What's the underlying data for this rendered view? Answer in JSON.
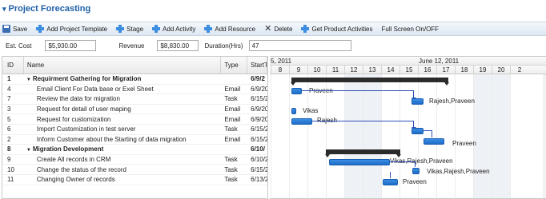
{
  "title": "Project Forecasting",
  "toolbar": {
    "save": "Save",
    "add_project_template": "Add Project Template",
    "stage": "Stage",
    "add_activity": "Add Activity",
    "add_resource": "Add Resource",
    "delete": "Delete",
    "get_product_activities": "Get Product Activities",
    "full_screen": "Full Screen On/OFF"
  },
  "fields": {
    "est_cost_label": "Est. Cost",
    "est_cost_value": "$5,930.00",
    "revenue_label": "Revenue",
    "revenue_value": "$8,830.00",
    "duration_label": "Duration(Hrs)",
    "duration_value": "47"
  },
  "grid": {
    "headers": {
      "id": "ID",
      "name": "Name",
      "type": "Type",
      "start": "StartTi"
    },
    "rows": [
      {
        "id": "1",
        "name": "Requirment Gathering for Migration",
        "type": "",
        "start": "6/9/2",
        "group": true
      },
      {
        "id": "4",
        "name": "Email Client For Data base or Exel Sheet",
        "type": "Email",
        "start": "6/9/20",
        "group": false
      },
      {
        "id": "7",
        "name": "Review the data for migration",
        "type": "Task",
        "start": "6/15/2",
        "group": false
      },
      {
        "id": "3",
        "name": "Request for detail of user maping",
        "type": "Email",
        "start": "6/9/20",
        "group": false
      },
      {
        "id": "5",
        "name": "Request for customization",
        "type": "Email",
        "start": "6/9/20",
        "group": false
      },
      {
        "id": "6",
        "name": "Import Customization in test server",
        "type": "Task",
        "start": "6/15/2",
        "group": false
      },
      {
        "id": "2",
        "name": "Inform Customer about the Starting of data migration",
        "type": "Email",
        "start": "6/15/2",
        "group": false
      },
      {
        "id": "8",
        "name": "Migration Development",
        "type": "",
        "start": "6/10/",
        "group": true
      },
      {
        "id": "9",
        "name": "Create All records in CRM",
        "type": "Task",
        "start": "6/10/2",
        "group": false
      },
      {
        "id": "10",
        "name": "Change the status of the record",
        "type": "Task",
        "start": "6/15/2",
        "group": false
      },
      {
        "id": "11",
        "name": "Changing Owner of records",
        "type": "Task",
        "start": "6/13/2",
        "group": false
      }
    ]
  },
  "gantt": {
    "week_left": "5, 2011",
    "week_right": "June 12, 2011",
    "days": [
      "8",
      "9",
      "10",
      "11",
      "12",
      "13",
      "14",
      "15",
      "16",
      "17",
      "18",
      "19",
      "20",
      "2"
    ],
    "resources": {
      "r_praveen_1": "Praveen",
      "r_rajesh_praveen": "Rajesh,Praveen",
      "r_vikas": "Vikas",
      "r_rajesh": "Rajesh",
      "r_praveen_2": "Praveen",
      "r_vikas_rajesh_praveen_1": "Vikas,Rajesh,Praveen",
      "r_vikas_rajesh_praveen_2": "Vikas,Rajesh,Praveen",
      "r_praveen_3": "Praveen"
    },
    "colors": {
      "bar": "#1e6dc8",
      "summary": "#2b2b2b",
      "weekend": "#eef1f5",
      "dependency": "#2d4fb8"
    }
  }
}
